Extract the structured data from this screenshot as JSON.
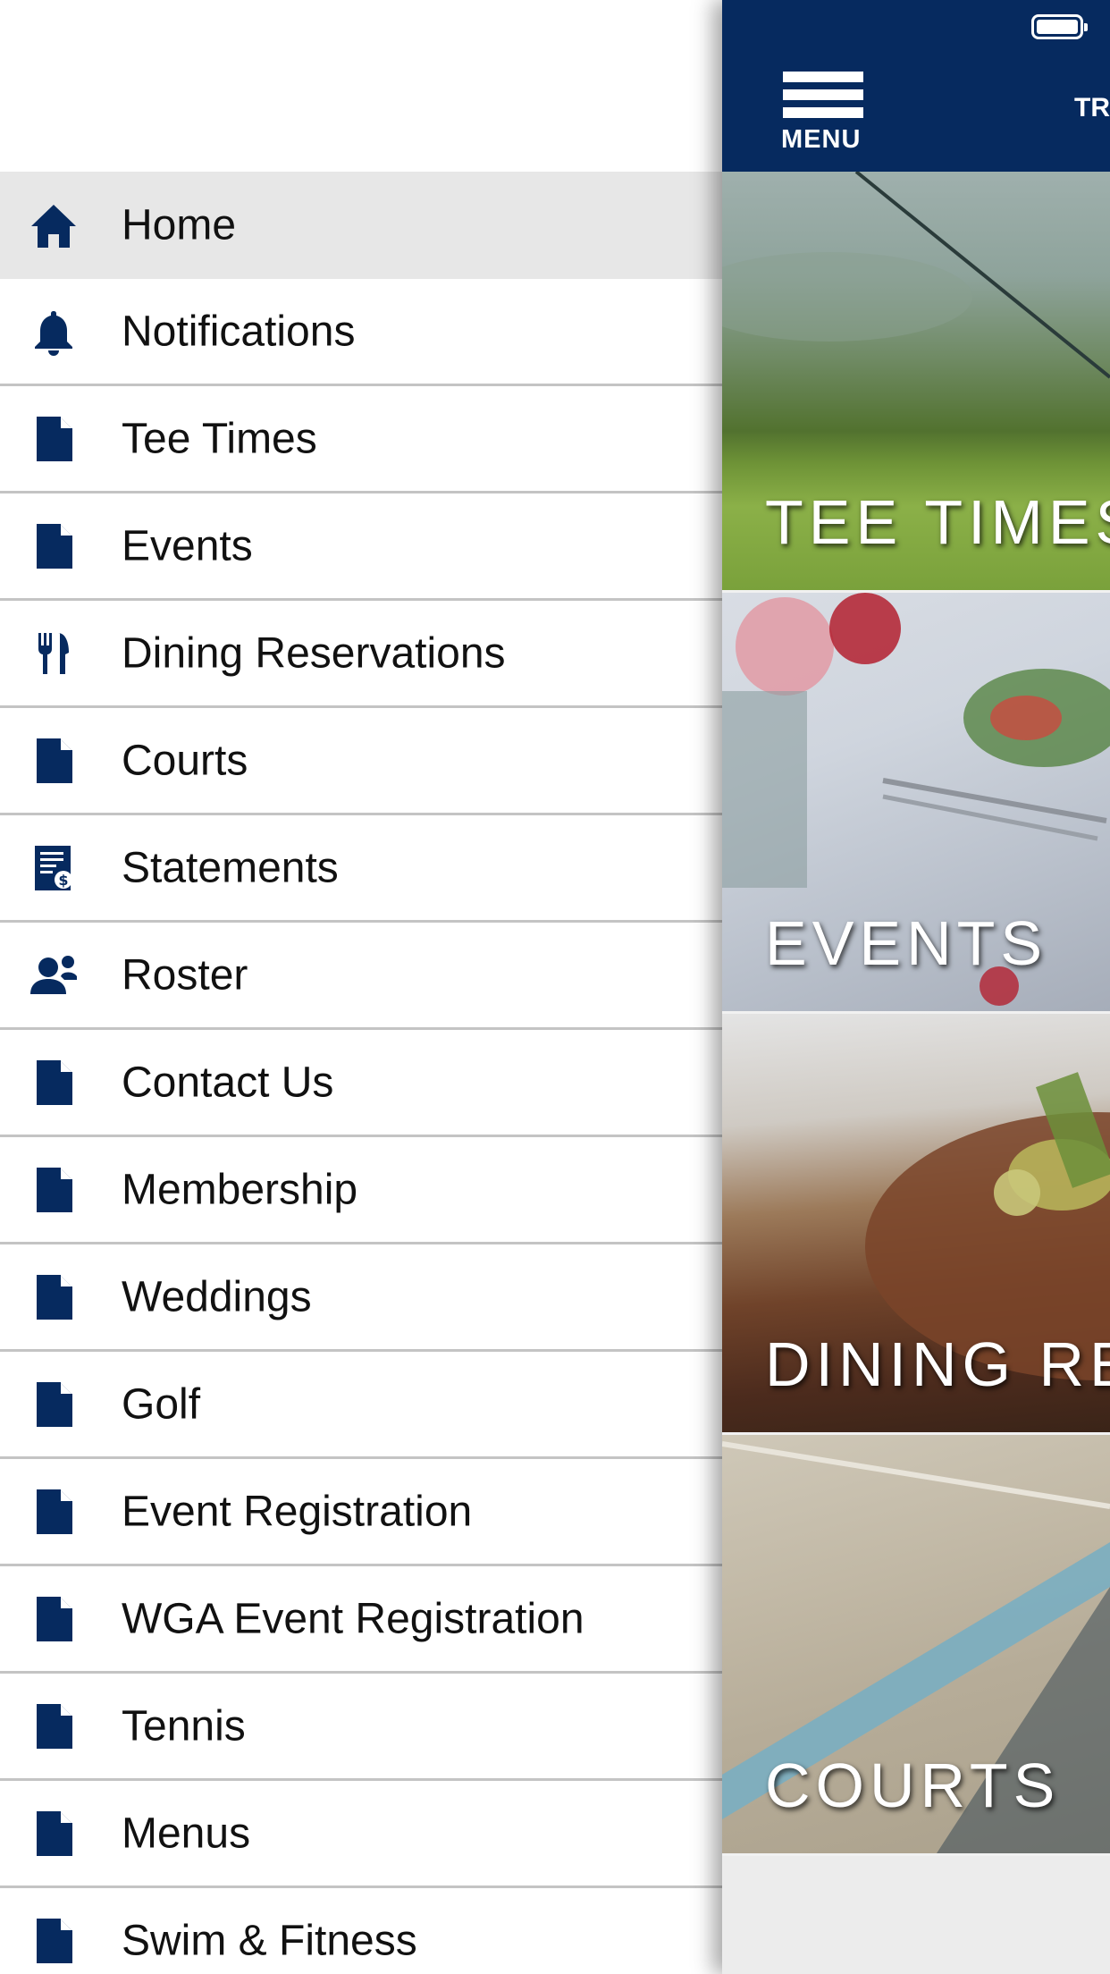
{
  "drawer": {
    "items": [
      {
        "label": "Home",
        "icon": "home-icon"
      },
      {
        "label": "Notifications",
        "icon": "bell-icon"
      },
      {
        "label": "Tee Times",
        "icon": "document-icon"
      },
      {
        "label": "Events",
        "icon": "document-icon"
      },
      {
        "label": "Dining Reservations",
        "icon": "utensils-icon"
      },
      {
        "label": "Courts",
        "icon": "document-icon"
      },
      {
        "label": "Statements",
        "icon": "statement-icon"
      },
      {
        "label": "Roster",
        "icon": "roster-icon"
      },
      {
        "label": "Contact Us",
        "icon": "document-icon"
      },
      {
        "label": "Membership",
        "icon": "document-icon"
      },
      {
        "label": "Weddings",
        "icon": "document-icon"
      },
      {
        "label": "Golf",
        "icon": "document-icon"
      },
      {
        "label": "Event Registration",
        "icon": "document-icon"
      },
      {
        "label": "WGA Event Registration",
        "icon": "document-icon"
      },
      {
        "label": "Tennis",
        "icon": "document-icon"
      },
      {
        "label": "Menus",
        "icon": "document-icon"
      },
      {
        "label": "Swim & Fitness",
        "icon": "document-icon"
      }
    ],
    "selected": "Home"
  },
  "header": {
    "menu_label": "MENU",
    "title_partial": "TR"
  },
  "tiles": [
    {
      "label": "TEE TIMES"
    },
    {
      "label": "EVENTS"
    },
    {
      "label": "DINING RE"
    },
    {
      "label": "COURTS"
    }
  ],
  "colors": {
    "navy": "#062a5f",
    "selected_bg": "#e7e7e7",
    "divider": "#c4c4c4"
  }
}
